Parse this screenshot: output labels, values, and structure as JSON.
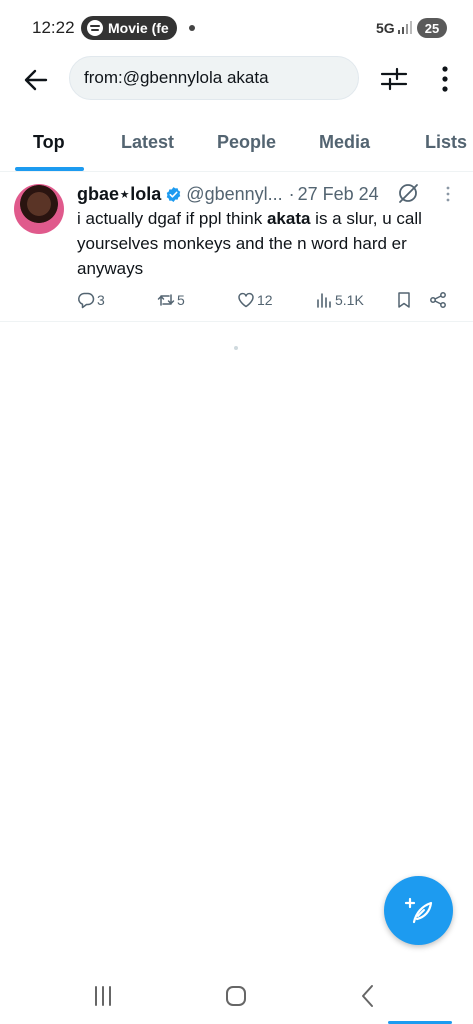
{
  "status_bar": {
    "time": "12:22",
    "media_pill": "Movie (fe",
    "network": "5G",
    "battery": "25"
  },
  "search": {
    "query": "from:@gbennylola akata"
  },
  "tabs": [
    {
      "label": "Top",
      "active": true
    },
    {
      "label": "Latest",
      "active": false
    },
    {
      "label": "People",
      "active": false
    },
    {
      "label": "Media",
      "active": false
    },
    {
      "label": "Lists",
      "active": false
    }
  ],
  "tweet": {
    "display_name": "gbae⋆lola",
    "handle": "@gbennyl...",
    "date": "27 Feb 24",
    "text_before": "i actually dgaf if ppl think ",
    "text_highlight": "akata",
    "text_after": " is a slur, u call yourselves monkeys and the n word hard er anyways",
    "replies": "3",
    "reposts": "5",
    "likes": "12",
    "views": "5.1K"
  },
  "colors": {
    "accent": "#1d9bf0",
    "text_primary": "#0f1419",
    "text_secondary": "#536471"
  }
}
